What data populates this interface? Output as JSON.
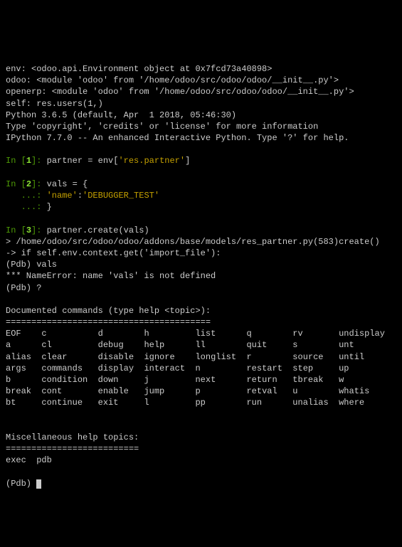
{
  "header": {
    "env": "env: <odoo.api.Environment object at 0x7fcd73a40898>",
    "odoo": "odoo: <module 'odoo' from '/home/odoo/src/odoo/odoo/__init__.py'>",
    "openerp": "openerp: <module 'odoo' from '/home/odoo/src/odoo/odoo/__init__.py'>",
    "self": "self: res.users(1,)",
    "python": "Python 3.6.5 (default, Apr  1 2018, 05:46:30)",
    "type": "Type 'copyright', 'credits' or 'license' for more information",
    "ipython": "IPython 7.7.0 -- An enhanced Interactive Python. Type '?' for help."
  },
  "in": {
    "label_pre": "In [",
    "label_post": "]: ",
    "n1": "1",
    "n2": "2",
    "n3": "3",
    "cont": "   ...: "
  },
  "code": {
    "c1a": "partner = env[",
    "c1b": "'res.partner'",
    "c1c": "]",
    "c2a": "vals = {",
    "c2b": "'name'",
    "c2c": ":",
    "c2d": "'DEBUGGER_TEST'",
    "c2e": "}",
    "c3": "partner.create(vals)"
  },
  "trace": {
    "t1": "> /home/odoo/src/odoo/odoo/addons/base/models/res_partner.py(583)create()",
    "t2": "-> if self.env.context.get('import_file'):",
    "pdb1": "(Pdb) vals",
    "err": "*** NameError: name 'vals' is not defined",
    "pdb2": "(Pdb) ?"
  },
  "help": {
    "title": "Documented commands (type help <topic>):",
    "sep": "========================================",
    "rows": [
      [
        "EOF    ",
        "c          ",
        "d        ",
        "h         ",
        "list      ",
        "q        ",
        "rv       ",
        "undisplay"
      ],
      [
        "a      ",
        "cl         ",
        "debug    ",
        "help      ",
        "ll        ",
        "quit     ",
        "s        ",
        "unt      "
      ],
      [
        "alias  ",
        "clear      ",
        "disable  ",
        "ignore    ",
        "longlist  ",
        "r        ",
        "source   ",
        "until    "
      ],
      [
        "args   ",
        "commands   ",
        "display  ",
        "interact  ",
        "n         ",
        "restart  ",
        "step     ",
        "up       "
      ],
      [
        "b      ",
        "condition  ",
        "down     ",
        "j         ",
        "next      ",
        "return   ",
        "tbreak   ",
        "w        "
      ],
      [
        "break  ",
        "cont       ",
        "enable   ",
        "jump      ",
        "p         ",
        "retval   ",
        "u        ",
        "whatis   "
      ],
      [
        "bt     ",
        "continue   ",
        "exit     ",
        "l         ",
        "pp        ",
        "run      ",
        "unalias  ",
        "where    "
      ]
    ],
    "misc_title": "Miscellaneous help topics:",
    "misc_sep": "==========================",
    "misc": "exec  pdb"
  },
  "prompt": "(Pdb) "
}
